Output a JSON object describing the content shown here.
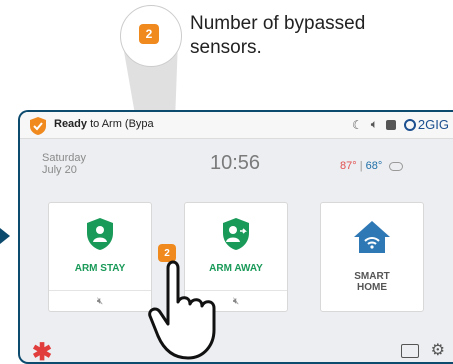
{
  "callout": {
    "badge": "2",
    "line1": "Number of bypassed",
    "line2": "sensors."
  },
  "topbar": {
    "status_strong": "Ready",
    "status_rest": " to Arm (Bypa",
    "brand": "2GIG",
    "icons": [
      "moon-icon",
      "speaker-icon",
      "camera-icon",
      "brand-logo-icon"
    ]
  },
  "info": {
    "day": "Saturday",
    "date": "July 20",
    "time": "10:56",
    "temp_high": "87°",
    "temp_sep": " | ",
    "temp_low": "68°"
  },
  "tiles": {
    "arm_stay": {
      "label": "ARM STAY"
    },
    "arm_away": {
      "label": "ARM AWAY"
    },
    "smart_home": {
      "line1": "SMART",
      "line2": "HOME"
    },
    "bypass_badge": "2"
  },
  "colors": {
    "accent": "#f08a1f",
    "green": "#1a9a59",
    "frame": "#0c4a6e",
    "temp_high": "#e25050",
    "temp_low": "#1f6fa8"
  }
}
